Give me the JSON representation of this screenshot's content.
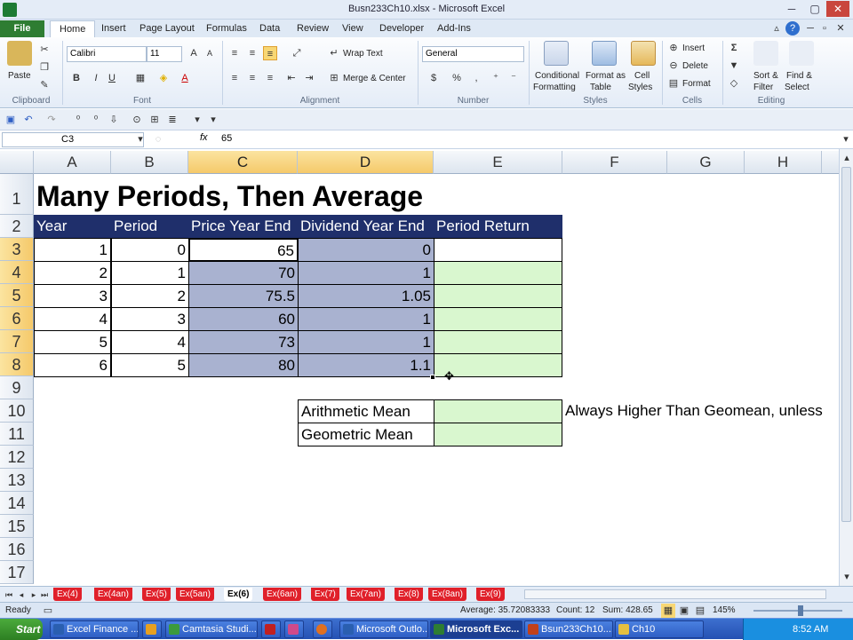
{
  "window": {
    "title": "Busn233Ch10.xlsx - Microsoft Excel"
  },
  "ribbon_tabs": [
    "File",
    "Home",
    "Insert",
    "Page Layout",
    "Formulas",
    "Data",
    "Review",
    "View",
    "Developer",
    "Add-Ins"
  ],
  "ribbon": {
    "clipboard": {
      "label": "Clipboard",
      "paste": "Paste"
    },
    "font": {
      "label": "Font",
      "name": "Calibri",
      "size": "11",
      "bold": "B",
      "italic": "I",
      "underline": "U"
    },
    "alignment": {
      "label": "Alignment",
      "wrap": "Wrap Text",
      "merge": "Merge & Center"
    },
    "number": {
      "label": "Number",
      "format": "General",
      "currency": "$",
      "percent": "%",
      "comma": ","
    },
    "styles": {
      "label": "Styles",
      "conditional": "Conditional",
      "conditional2": "Formatting",
      "format_table": "Format as",
      "format_table2": "Table",
      "cell_styles": "Cell",
      "cell_styles2": "Styles"
    },
    "cells": {
      "label": "Cells",
      "insert": "Insert",
      "delete": "Delete",
      "format": "Format"
    },
    "editing": {
      "label": "Editing",
      "sigma": "Σ",
      "sort": "Sort &",
      "sort2": "Filter",
      "find": "Find &",
      "find2": "Select"
    }
  },
  "formula_bar": {
    "name_box": "C3",
    "fx": "fx",
    "value": "65"
  },
  "columns": [
    "A",
    "B",
    "C",
    "D",
    "E",
    "F",
    "G",
    "H"
  ],
  "rows": [
    "1",
    "2",
    "3",
    "4",
    "5",
    "6",
    "7",
    "8",
    "9",
    "10",
    "11",
    "12",
    "13",
    "14",
    "15",
    "16",
    "17"
  ],
  "sheet": {
    "title": "Many Periods, Then Average",
    "headers": [
      "Year",
      "Period",
      "Price Year End",
      "Dividend Year End",
      "Period Return"
    ],
    "data": [
      [
        "1",
        "0",
        "65",
        "0"
      ],
      [
        "2",
        "1",
        "70",
        "1"
      ],
      [
        "3",
        "2",
        "75.5",
        "1.05"
      ],
      [
        "4",
        "3",
        "60",
        "1"
      ],
      [
        "5",
        "4",
        "73",
        "1"
      ],
      [
        "6",
        "5",
        "80",
        "1.1"
      ]
    ],
    "arith": "Arithmetic Mean",
    "geo": "Geometric Mean",
    "note": "Always Higher Than Geomean, unless"
  },
  "sheet_tabs": [
    "Ex(4)",
    "Ex(4an)",
    "Ex(5)",
    "Ex(5an)",
    "Ex(6)",
    "Ex(6an)",
    "Ex(7)",
    "Ex(7an)",
    "Ex(8)",
    "Ex(8an)",
    "Ex(9)"
  ],
  "status": {
    "ready": "Ready",
    "average": "Average: 35.72083333",
    "count": "Count: 12",
    "sum": "Sum: 428.65",
    "zoom": "145%"
  },
  "taskbar": {
    "start": "Start",
    "items": [
      "Excel Finance ...",
      "",
      "Camtasia Studi...",
      "",
      "",
      "Microsoft Outlo...",
      "Microsoft Exc...",
      "Bsun233Ch10....",
      "Ch10"
    ],
    "time": "8:52 AM"
  },
  "colors": {
    "header_bg": "#1f2f6b",
    "selection": "#a9b2d0",
    "input": "#d9f7cf",
    "file_tab": "#2e7d32"
  }
}
